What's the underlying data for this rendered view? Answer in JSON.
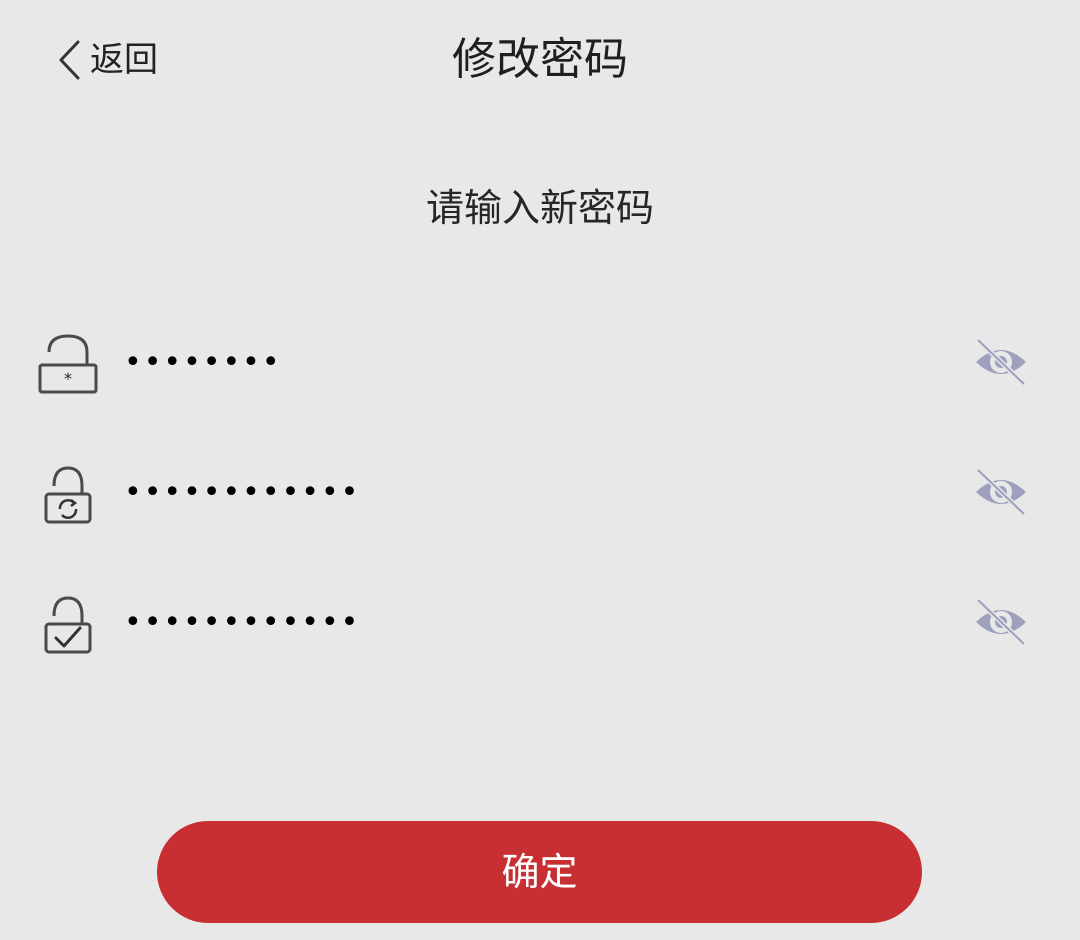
{
  "header": {
    "back_label": "返回",
    "title": "修改密码"
  },
  "subtitle": "请输入新密码",
  "fields": [
    {
      "icon": "lock-asterisk-icon",
      "value": "••••••••"
    },
    {
      "icon": "lock-refresh-icon",
      "value": "••••••••••••"
    },
    {
      "icon": "lock-check-icon",
      "value": "••••••••••••"
    }
  ],
  "toggle_icon": "eye-hidden-icon",
  "confirm_label": "确定",
  "colors": {
    "background": "#e8e8e8",
    "accent": "#c72f32",
    "eye_icon": "#9ea1bd",
    "text": "#222222"
  }
}
